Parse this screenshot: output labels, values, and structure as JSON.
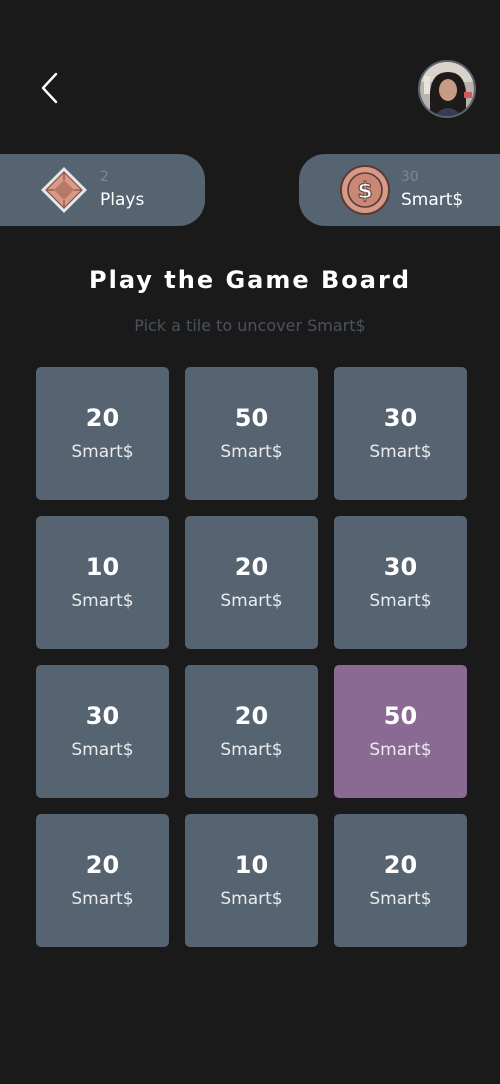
{
  "header": {
    "back_icon": "chevron-left-icon",
    "avatar_icon": "user-avatar"
  },
  "stats": {
    "plays": {
      "value": "2",
      "label": "Plays",
      "icon": "diamond-gem-icon"
    },
    "smart": {
      "value": "30",
      "label": "Smart$",
      "icon": "dollar-coin-icon"
    }
  },
  "board": {
    "title": "Play the Game Board",
    "subtitle": "Pick a tile to uncover Smart$",
    "tiles": [
      {
        "value": "20",
        "unit": "Smart$"
      },
      {
        "value": "50",
        "unit": "Smart$"
      },
      {
        "value": "30",
        "unit": "Smart$"
      },
      {
        "value": "10",
        "unit": "Smart$"
      },
      {
        "value": "20",
        "unit": "Smart$"
      },
      {
        "value": "30",
        "unit": "Smart$"
      },
      {
        "value": "30",
        "unit": "Smart$"
      },
      {
        "value": "20",
        "unit": "Smart$"
      },
      {
        "value": "50",
        "unit": "Smart$",
        "selected": true
      },
      {
        "value": "20",
        "unit": "Smart$"
      },
      {
        "value": "10",
        "unit": "Smart$"
      },
      {
        "value": "20",
        "unit": "Smart$"
      }
    ]
  },
  "colors": {
    "background": "#1b1a1b",
    "card": "#566370",
    "selected_tile": "#8a6a92",
    "subtitle": "#4a525b",
    "icon_accent": "#d89a88"
  }
}
